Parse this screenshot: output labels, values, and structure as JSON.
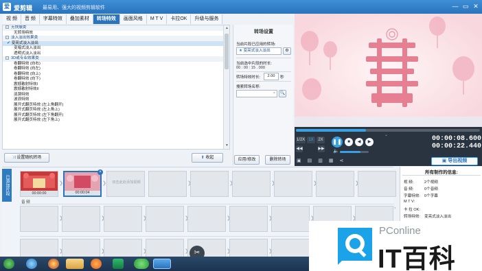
{
  "window": {
    "app_name": "爱剪辑",
    "slogan": "最易用、强大的视频剪辑软件",
    "controls": {
      "min": "—",
      "restore": "▭",
      "close": "✕"
    }
  },
  "tabs": [
    {
      "label": "视 频"
    },
    {
      "label": "音 频"
    },
    {
      "label": "字幕特效"
    },
    {
      "label": "叠加素材"
    },
    {
      "label": "转场特效",
      "active": true
    },
    {
      "label": "画面风格"
    },
    {
      "label": "M T V"
    },
    {
      "label": "卡拉OK"
    },
    {
      "label": "升级与服务"
    }
  ],
  "transition_list": [
    {
      "label": "无快展类",
      "type": "cat"
    },
    {
      "label": "无转场特效",
      "type": "sub"
    },
    {
      "label": "淡入淡出效果类",
      "type": "cat"
    },
    {
      "label": "变亮式淡入淡出",
      "type": "sub",
      "selected": true
    },
    {
      "label": "变暗式淡入淡出",
      "type": "sub"
    },
    {
      "label": "透明式淡入淡出",
      "type": "sub"
    },
    {
      "label": "3D或专业效果类",
      "type": "cat"
    },
    {
      "label": "卷翻特效 (向右)",
      "type": "sub"
    },
    {
      "label": "卷翻特效 (向左)",
      "type": "sub"
    },
    {
      "label": "卷翻特效 (向上)",
      "type": "sub"
    },
    {
      "label": "卷翻特效 (向下)",
      "type": "sub"
    },
    {
      "label": "震撼散射特效I",
      "type": "sub"
    },
    {
      "label": "震撼散射特效II",
      "type": "sub"
    },
    {
      "label": "涟漪特效",
      "type": "sub"
    },
    {
      "label": "波浪特效",
      "type": "sub"
    },
    {
      "label": "展开式翻页特效 (左上角翻开)",
      "type": "sub"
    },
    {
      "label": "展开式翻页特效 (左上角上)",
      "type": "sub"
    },
    {
      "label": "展开式翻页特效 (左下角翻开)",
      "type": "sub"
    },
    {
      "label": "展开式翻页特效 (左下角上)",
      "type": "sub"
    }
  ],
  "left_buttons": {
    "random": "设置随机转场",
    "collapse": "收起"
  },
  "settings": {
    "header": "转场设置",
    "current_label": "当前片段已应用的转场:",
    "current_value": "变亮式淡入淡出",
    "duration_label": "当前选中片段的时长:",
    "duration_value": "00 : 00 : 15 . 000",
    "effect_time_label": "转场特效时长:",
    "effect_time_value": "2.00",
    "effect_time_unit": "秒",
    "search_label": "搜索转场名称:",
    "search_placeholder": "",
    "apply_button": "应用/修改",
    "delete_button": "删除转场"
  },
  "player": {
    "speeds": [
      "1/2X",
      "1X",
      "2X"
    ],
    "current_time": "00:00:08.600",
    "total_time": "00:00:22.440",
    "export_label": "导出视频",
    "progress": 0.38,
    "volume": 0.72
  },
  "timeline": {
    "side_label": "已添加片段",
    "clips": [
      {
        "time": "00:00:00"
      },
      {
        "time": "00:00:04"
      }
    ],
    "placeholder_text": "双击此处添加视频",
    "audio_label": "音 频"
  },
  "info_panel": {
    "header": "所有制作的信息:",
    "lines": [
      {
        "k": "视    频:",
        "v": "2个视频"
      },
      {
        "k": "音    频:",
        "v": "0个音频"
      },
      {
        "k": "字幕特效:",
        "v": "0个字幕"
      },
      {
        "k": "M T V:",
        "v": ""
      },
      {
        "k": "卡 拉 OK:",
        "v": ""
      },
      {
        "k": "转场特效:",
        "v": "变亮式淡入淡出"
      }
    ]
  },
  "watermark": {
    "brand_small": "PConline",
    "brand_large": "IT百科"
  },
  "colors": {
    "accent": "#2a74bd",
    "dark": "#2a3440",
    "export_green": "#3aa1e3"
  }
}
